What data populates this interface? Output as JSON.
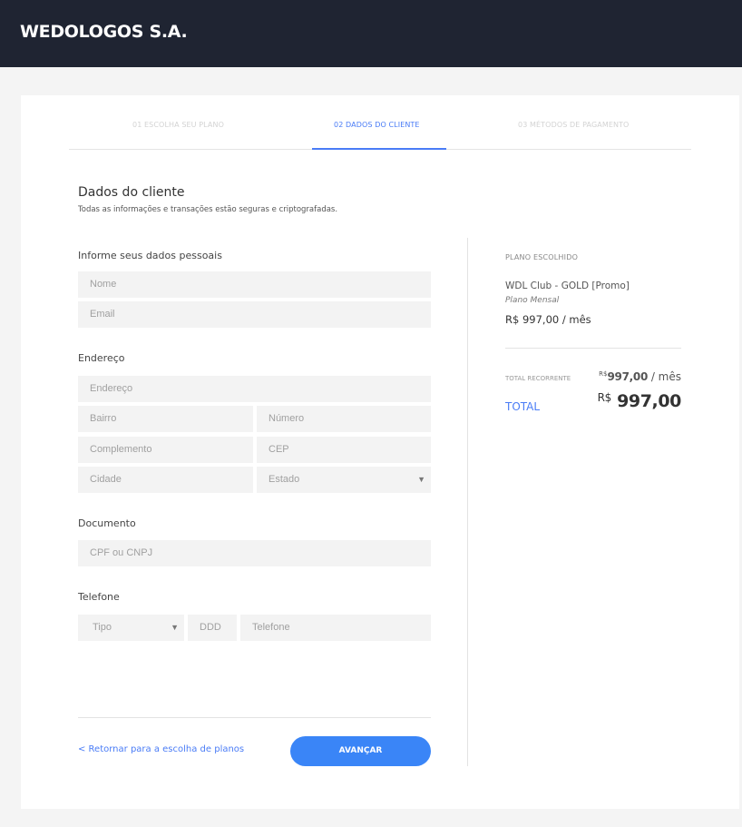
{
  "header": {
    "brand": "WEDOLOGOS S.A."
  },
  "steps": [
    {
      "label": "01 ESCOLHA SEU PLANO",
      "active": false
    },
    {
      "label": "02 DADOS DO CLIENTE",
      "active": true
    },
    {
      "label": "03 MÉTODOS DE PAGAMENTO",
      "active": false
    }
  ],
  "colors": {
    "accent": "#4a7cf6",
    "button": "#3a85f7",
    "topbar": "#1f2432"
  },
  "form": {
    "title": "Dados do cliente",
    "subtitle": "Todas as informações e transações estão seguras e criptografadas.",
    "personal": {
      "title": "Informe seus dados pessoais",
      "name_placeholder": "Nome",
      "email_placeholder": "Email"
    },
    "address": {
      "title": "Endereço",
      "street_placeholder": "Endereço",
      "district_placeholder": "Bairro",
      "number_placeholder": "Número",
      "complement_placeholder": "Complemento",
      "zip_placeholder": "CEP",
      "city_placeholder": "Cidade",
      "state_placeholder": "Estado"
    },
    "document": {
      "title": "Documento",
      "placeholder": "CPF ou CNPJ"
    },
    "phone": {
      "title": "Telefone",
      "type_placeholder": "Tipo",
      "ddd_placeholder": "DDD",
      "number_placeholder": "Telefone"
    },
    "back_link": "< Retornar para a escolha de planos",
    "next_button": "AVANÇAR"
  },
  "summary": {
    "label": "PLANO ESCOLHIDO",
    "plan_name": "WDL Club - GOLD [Promo]",
    "plan_period": "Plano Mensal",
    "plan_price": "R$ 997,00 / mês",
    "recurring_label": "TOTAL RECORRENTE",
    "recurring_currency": "R$",
    "recurring_amount": "997,00",
    "recurring_suffix": " / mês",
    "total_label": "TOTAL",
    "total_currency": "R$",
    "total_amount": "997,00"
  }
}
